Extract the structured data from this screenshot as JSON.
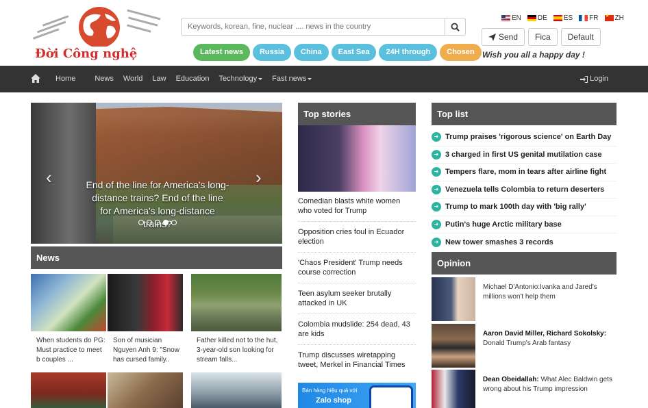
{
  "logo": {
    "text": "Đời Công nghệ"
  },
  "search": {
    "placeholder": "Keywords, korean, fine, nuclear .... news in the country"
  },
  "tags": [
    {
      "label": "Latest news",
      "color": "#5cb85c"
    },
    {
      "label": "Russia",
      "color": "#5bc0de"
    },
    {
      "label": "China",
      "color": "#5bc0de"
    },
    {
      "label": "East Sea",
      "color": "#5bc0de"
    },
    {
      "label": "24H through",
      "color": "#5bc0de"
    },
    {
      "label": "Chosen",
      "color": "#f0ad4e"
    }
  ],
  "languages": [
    "EN",
    "DE",
    "ES",
    "FR",
    "ZH"
  ],
  "actions": {
    "send": "Send",
    "fica": "Fica",
    "default": "Default"
  },
  "greeting": "Wish you all a happy day !",
  "nav": {
    "items": [
      "Home",
      "News",
      "World",
      "Law",
      "Education",
      "Technology",
      "Fast news"
    ],
    "login": "Login"
  },
  "slider": {
    "caption": "End of the line for America's long-distance trains? End of the line for America's long-distance trains?"
  },
  "sections": {
    "news": "News",
    "top_stories": "Top stories",
    "top_list": "Top list",
    "opinion": "Opinion"
  },
  "news": [
    {
      "caption": "When students do PG: Must practice to meet b couples ..."
    },
    {
      "caption": "Son of musician Nguyen Anh 9: \"Snow has cursed family.."
    },
    {
      "caption": "Father killed not to the hut, 3-year-old son looking for stream falls..."
    }
  ],
  "top_stories": [
    "Comedian blasts white women who voted for Trump",
    "Opposition cries foul in Ecuador election",
    "'Chaos President' Trump needs course correction",
    "Teen asylum seeker brutally attacked in UK",
    "Colombia mudslide: 254 dead, 43 are kids",
    "Trump discusses wiretapping tweet, Merkel in Financial Times"
  ],
  "ad": {
    "line1": "Bán hàng hiệu quả với",
    "brand": "Zalo shop"
  },
  "top_list": [
    "Trump praises 'rigorous science' on Earth Day",
    "3 charged in first US genital mutilation case",
    "Tempers flare, mom in tears after airline fight",
    "Venezuela tells Colombia to return deserters",
    "Trump to mark 100th day with 'big rally'",
    "Putin's huge Arctic military base",
    "New tower smashes 3 records"
  ],
  "opinion": [
    {
      "author": "",
      "text": "Michael D'Antonio:Ivanka and Jared's millions won't help them"
    },
    {
      "author": "Aaron David Miller, Richard Sokolsky:",
      "text": " Donald Trump's Arab fantasy"
    },
    {
      "author": "Dean Obeidallah:",
      "text": " What Alec Baldwin gets wrong about his Trump impression"
    }
  ]
}
